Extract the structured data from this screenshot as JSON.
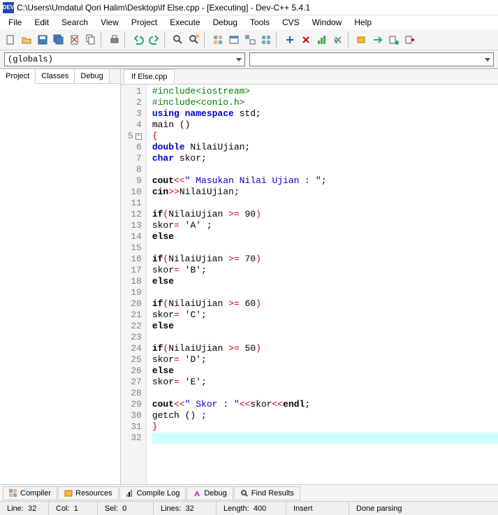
{
  "title": "C:\\Users\\Umdatul Qori Halim\\Desktop\\If Else.cpp - [Executing] - Dev-C++ 5.4.1",
  "app_icon_text": "DEV",
  "menus": [
    "File",
    "Edit",
    "Search",
    "View",
    "Project",
    "Execute",
    "Debug",
    "Tools",
    "CVS",
    "Window",
    "Help"
  ],
  "combo_left": "(globals)",
  "combo_right": "",
  "left_tabs": [
    "Project",
    "Classes",
    "Debug"
  ],
  "editor_tab": "If Else.cpp",
  "code_lines": [
    {
      "n": 1,
      "seg": [
        {
          "t": "#include<iostream>",
          "c": "k-green"
        }
      ]
    },
    {
      "n": 2,
      "seg": [
        {
          "t": "#include<conio.h>",
          "c": "k-green"
        }
      ]
    },
    {
      "n": 3,
      "seg": [
        {
          "t": "using namespace ",
          "c": "k-blue"
        },
        {
          "t": "std;",
          "c": "k-norm"
        }
      ]
    },
    {
      "n": 4,
      "seg": [
        {
          "t": "main ()",
          "c": "k-norm"
        }
      ]
    },
    {
      "n": 5,
      "fold": true,
      "seg": [
        {
          "t": "{",
          "c": "k-red"
        }
      ]
    },
    {
      "n": 6,
      "seg": [
        {
          "t": "double ",
          "c": "k-blue"
        },
        {
          "t": "NilaiUjian;",
          "c": "k-norm"
        }
      ]
    },
    {
      "n": 7,
      "seg": [
        {
          "t": "char ",
          "c": "k-blue"
        },
        {
          "t": "skor;",
          "c": "k-norm"
        }
      ]
    },
    {
      "n": 8,
      "seg": []
    },
    {
      "n": 9,
      "seg": [
        {
          "t": "cout",
          "c": "k-black"
        },
        {
          "t": "<<",
          "c": "k-red"
        },
        {
          "t": "\" Masukan Nilai Ujian : \"",
          "c": "k-str"
        },
        {
          "t": ";",
          "c": "k-norm"
        }
      ]
    },
    {
      "n": 10,
      "seg": [
        {
          "t": "cin",
          "c": "k-black"
        },
        {
          "t": ">>",
          "c": "k-red"
        },
        {
          "t": "NilaiUjian;",
          "c": "k-norm"
        }
      ]
    },
    {
      "n": 11,
      "seg": []
    },
    {
      "n": 12,
      "seg": [
        {
          "t": "if",
          "c": "k-black"
        },
        {
          "t": "(",
          "c": "k-red"
        },
        {
          "t": "NilaiUjian ",
          "c": "k-norm"
        },
        {
          "t": ">= ",
          "c": "k-red"
        },
        {
          "t": "90",
          "c": "k-norm"
        },
        {
          "t": ")",
          "c": "k-red"
        }
      ]
    },
    {
      "n": 13,
      "seg": [
        {
          "t": "skor",
          "c": "k-norm"
        },
        {
          "t": "= ",
          "c": "k-red"
        },
        {
          "t": "'A'",
          "c": "k-norm"
        },
        {
          "t": " ;",
          "c": "k-norm"
        }
      ]
    },
    {
      "n": 14,
      "seg": [
        {
          "t": "else",
          "c": "k-black"
        }
      ]
    },
    {
      "n": 15,
      "seg": []
    },
    {
      "n": 16,
      "seg": [
        {
          "t": "if",
          "c": "k-black"
        },
        {
          "t": "(",
          "c": "k-red"
        },
        {
          "t": "NilaiUjian ",
          "c": "k-norm"
        },
        {
          "t": ">= ",
          "c": "k-red"
        },
        {
          "t": "70",
          "c": "k-norm"
        },
        {
          "t": ")",
          "c": "k-red"
        }
      ]
    },
    {
      "n": 17,
      "seg": [
        {
          "t": "skor",
          "c": "k-norm"
        },
        {
          "t": "= ",
          "c": "k-red"
        },
        {
          "t": "'B'",
          "c": "k-norm"
        },
        {
          "t": ";",
          "c": "k-norm"
        }
      ]
    },
    {
      "n": 18,
      "seg": [
        {
          "t": "else",
          "c": "k-black"
        }
      ]
    },
    {
      "n": 19,
      "seg": []
    },
    {
      "n": 20,
      "seg": [
        {
          "t": "if",
          "c": "k-black"
        },
        {
          "t": "(",
          "c": "k-red"
        },
        {
          "t": "NilaiUjian ",
          "c": "k-norm"
        },
        {
          "t": ">= ",
          "c": "k-red"
        },
        {
          "t": "60",
          "c": "k-norm"
        },
        {
          "t": ")",
          "c": "k-red"
        }
      ]
    },
    {
      "n": 21,
      "seg": [
        {
          "t": "skor",
          "c": "k-norm"
        },
        {
          "t": "= ",
          "c": "k-red"
        },
        {
          "t": "'C'",
          "c": "k-norm"
        },
        {
          "t": ";",
          "c": "k-norm"
        }
      ]
    },
    {
      "n": 22,
      "seg": [
        {
          "t": "else",
          "c": "k-black"
        }
      ]
    },
    {
      "n": 23,
      "seg": []
    },
    {
      "n": 24,
      "seg": [
        {
          "t": "if",
          "c": "k-black"
        },
        {
          "t": "(",
          "c": "k-red"
        },
        {
          "t": "NilaiUjian ",
          "c": "k-norm"
        },
        {
          "t": ">= ",
          "c": "k-red"
        },
        {
          "t": "50",
          "c": "k-norm"
        },
        {
          "t": ")",
          "c": "k-red"
        }
      ]
    },
    {
      "n": 25,
      "seg": [
        {
          "t": "skor",
          "c": "k-norm"
        },
        {
          "t": "= ",
          "c": "k-red"
        },
        {
          "t": "'D'",
          "c": "k-norm"
        },
        {
          "t": ";",
          "c": "k-norm"
        }
      ]
    },
    {
      "n": 26,
      "seg": [
        {
          "t": "else",
          "c": "k-black"
        }
      ]
    },
    {
      "n": 27,
      "seg": [
        {
          "t": "skor",
          "c": "k-norm"
        },
        {
          "t": "= ",
          "c": "k-red"
        },
        {
          "t": "'E'",
          "c": "k-norm"
        },
        {
          "t": ";",
          "c": "k-norm"
        }
      ]
    },
    {
      "n": 28,
      "seg": []
    },
    {
      "n": 29,
      "seg": [
        {
          "t": "cout",
          "c": "k-black"
        },
        {
          "t": "<<",
          "c": "k-red"
        },
        {
          "t": "\" Skor : \"",
          "c": "k-str"
        },
        {
          "t": "<<",
          "c": "k-red"
        },
        {
          "t": "skor",
          "c": "k-norm"
        },
        {
          "t": "<<",
          "c": "k-red"
        },
        {
          "t": "endl",
          "c": "k-black"
        },
        {
          "t": ";",
          "c": "k-norm"
        }
      ]
    },
    {
      "n": 30,
      "seg": [
        {
          "t": "getch () ;",
          "c": "k-norm"
        }
      ]
    },
    {
      "n": 31,
      "seg": [
        {
          "t": "}",
          "c": "k-red"
        }
      ]
    },
    {
      "n": 32,
      "hl": true,
      "seg": []
    }
  ],
  "bottom_tabs": [
    {
      "label": "Compiler",
      "icon": "compiler-icon"
    },
    {
      "label": "Resources",
      "icon": "resources-icon"
    },
    {
      "label": "Compile Log",
      "icon": "compile-log-icon"
    },
    {
      "label": "Debug",
      "icon": "debug-icon"
    },
    {
      "label": "Find Results",
      "icon": "find-results-icon"
    }
  ],
  "status": {
    "line_label": "Line:",
    "line": "32",
    "col_label": "Col:",
    "col": "1",
    "sel_label": "Sel:",
    "sel": "0",
    "lines_label": "Lines:",
    "lines": "32",
    "length_label": "Length:",
    "length": "400",
    "mode": "Insert",
    "parse": "Done parsing"
  }
}
